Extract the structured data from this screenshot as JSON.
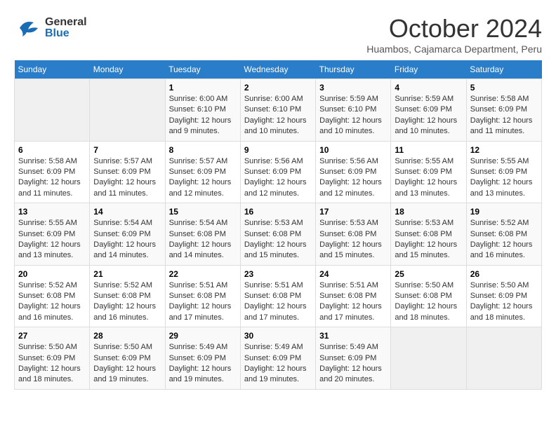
{
  "header": {
    "logo_general": "General",
    "logo_blue": "Blue",
    "month_title": "October 2024",
    "location": "Huambos, Cajamarca Department, Peru"
  },
  "days_of_week": [
    "Sunday",
    "Monday",
    "Tuesday",
    "Wednesday",
    "Thursday",
    "Friday",
    "Saturday"
  ],
  "weeks": [
    [
      {
        "day": "",
        "content": ""
      },
      {
        "day": "",
        "content": ""
      },
      {
        "day": "1",
        "content": "Sunrise: 6:00 AM\nSunset: 6:10 PM\nDaylight: 12 hours\nand 9 minutes."
      },
      {
        "day": "2",
        "content": "Sunrise: 6:00 AM\nSunset: 6:10 PM\nDaylight: 12 hours\nand 10 minutes."
      },
      {
        "day": "3",
        "content": "Sunrise: 5:59 AM\nSunset: 6:10 PM\nDaylight: 12 hours\nand 10 minutes."
      },
      {
        "day": "4",
        "content": "Sunrise: 5:59 AM\nSunset: 6:09 PM\nDaylight: 12 hours\nand 10 minutes."
      },
      {
        "day": "5",
        "content": "Sunrise: 5:58 AM\nSunset: 6:09 PM\nDaylight: 12 hours\nand 11 minutes."
      }
    ],
    [
      {
        "day": "6",
        "content": "Sunrise: 5:58 AM\nSunset: 6:09 PM\nDaylight: 12 hours\nand 11 minutes."
      },
      {
        "day": "7",
        "content": "Sunrise: 5:57 AM\nSunset: 6:09 PM\nDaylight: 12 hours\nand 11 minutes."
      },
      {
        "day": "8",
        "content": "Sunrise: 5:57 AM\nSunset: 6:09 PM\nDaylight: 12 hours\nand 12 minutes."
      },
      {
        "day": "9",
        "content": "Sunrise: 5:56 AM\nSunset: 6:09 PM\nDaylight: 12 hours\nand 12 minutes."
      },
      {
        "day": "10",
        "content": "Sunrise: 5:56 AM\nSunset: 6:09 PM\nDaylight: 12 hours\nand 12 minutes."
      },
      {
        "day": "11",
        "content": "Sunrise: 5:55 AM\nSunset: 6:09 PM\nDaylight: 12 hours\nand 13 minutes."
      },
      {
        "day": "12",
        "content": "Sunrise: 5:55 AM\nSunset: 6:09 PM\nDaylight: 12 hours\nand 13 minutes."
      }
    ],
    [
      {
        "day": "13",
        "content": "Sunrise: 5:55 AM\nSunset: 6:09 PM\nDaylight: 12 hours\nand 13 minutes."
      },
      {
        "day": "14",
        "content": "Sunrise: 5:54 AM\nSunset: 6:09 PM\nDaylight: 12 hours\nand 14 minutes."
      },
      {
        "day": "15",
        "content": "Sunrise: 5:54 AM\nSunset: 6:08 PM\nDaylight: 12 hours\nand 14 minutes."
      },
      {
        "day": "16",
        "content": "Sunrise: 5:53 AM\nSunset: 6:08 PM\nDaylight: 12 hours\nand 15 minutes."
      },
      {
        "day": "17",
        "content": "Sunrise: 5:53 AM\nSunset: 6:08 PM\nDaylight: 12 hours\nand 15 minutes."
      },
      {
        "day": "18",
        "content": "Sunrise: 5:53 AM\nSunset: 6:08 PM\nDaylight: 12 hours\nand 15 minutes."
      },
      {
        "day": "19",
        "content": "Sunrise: 5:52 AM\nSunset: 6:08 PM\nDaylight: 12 hours\nand 16 minutes."
      }
    ],
    [
      {
        "day": "20",
        "content": "Sunrise: 5:52 AM\nSunset: 6:08 PM\nDaylight: 12 hours\nand 16 minutes."
      },
      {
        "day": "21",
        "content": "Sunrise: 5:52 AM\nSunset: 6:08 PM\nDaylight: 12 hours\nand 16 minutes."
      },
      {
        "day": "22",
        "content": "Sunrise: 5:51 AM\nSunset: 6:08 PM\nDaylight: 12 hours\nand 17 minutes."
      },
      {
        "day": "23",
        "content": "Sunrise: 5:51 AM\nSunset: 6:08 PM\nDaylight: 12 hours\nand 17 minutes."
      },
      {
        "day": "24",
        "content": "Sunrise: 5:51 AM\nSunset: 6:08 PM\nDaylight: 12 hours\nand 17 minutes."
      },
      {
        "day": "25",
        "content": "Sunrise: 5:50 AM\nSunset: 6:08 PM\nDaylight: 12 hours\nand 18 minutes."
      },
      {
        "day": "26",
        "content": "Sunrise: 5:50 AM\nSunset: 6:09 PM\nDaylight: 12 hours\nand 18 minutes."
      }
    ],
    [
      {
        "day": "27",
        "content": "Sunrise: 5:50 AM\nSunset: 6:09 PM\nDaylight: 12 hours\nand 18 minutes."
      },
      {
        "day": "28",
        "content": "Sunrise: 5:50 AM\nSunset: 6:09 PM\nDaylight: 12 hours\nand 19 minutes."
      },
      {
        "day": "29",
        "content": "Sunrise: 5:49 AM\nSunset: 6:09 PM\nDaylight: 12 hours\nand 19 minutes."
      },
      {
        "day": "30",
        "content": "Sunrise: 5:49 AM\nSunset: 6:09 PM\nDaylight: 12 hours\nand 19 minutes."
      },
      {
        "day": "31",
        "content": "Sunrise: 5:49 AM\nSunset: 6:09 PM\nDaylight: 12 hours\nand 20 minutes."
      },
      {
        "day": "",
        "content": ""
      },
      {
        "day": "",
        "content": ""
      }
    ]
  ]
}
